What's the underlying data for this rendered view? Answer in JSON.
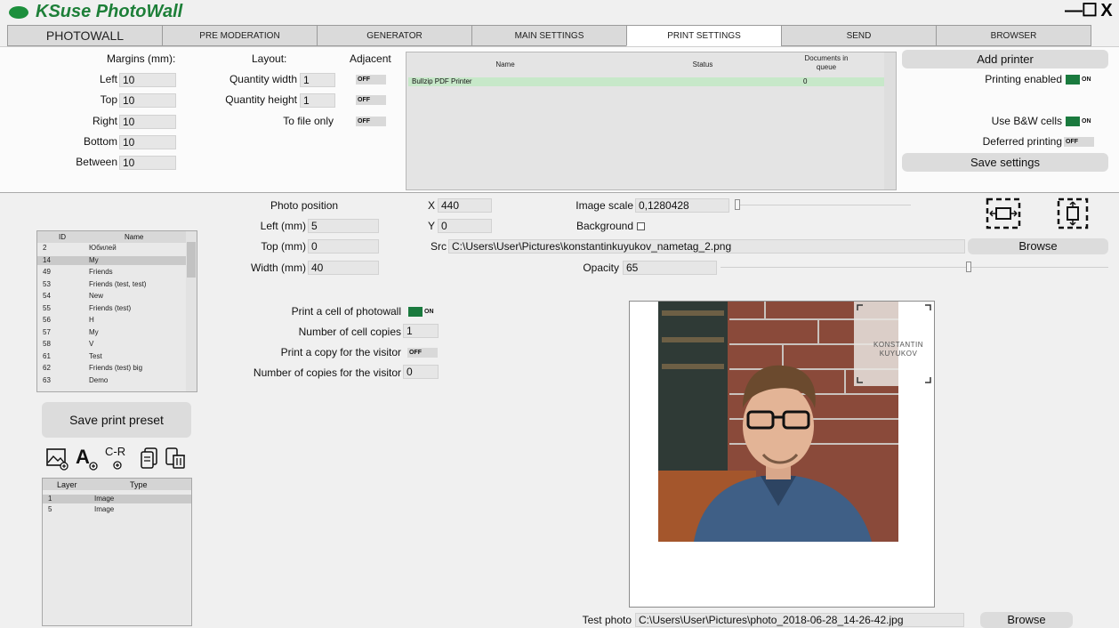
{
  "app": {
    "title": "KSuse PhotoWall"
  },
  "window": {
    "minimize": "—",
    "maximize": "☐",
    "close": "X"
  },
  "tabs": [
    "PHOTOWALL",
    "PRE MODERATION",
    "GENERATOR",
    "MAIN SETTINGS",
    "PRINT SETTINGS",
    "SEND",
    "BROWSER"
  ],
  "margins": {
    "header": "Margins (mm):",
    "left_label": "Left",
    "left": "10",
    "top_label": "Top",
    "top": "10",
    "right_label": "Right",
    "right": "10",
    "bottom_label": "Bottom",
    "bottom": "10",
    "between_label": "Between",
    "between": "10"
  },
  "layout": {
    "header": "Layout:",
    "adjacent_header": "Adjacent",
    "qty_width_label": "Quantity width",
    "qty_width": "1",
    "qty_height_label": "Quantity height",
    "qty_height": "1",
    "to_file_label": "To file only",
    "toggles": [
      "OFF",
      "OFF",
      "OFF"
    ]
  },
  "printers": {
    "col_name": "Name",
    "col_status": "Status",
    "col_docs": "Documents in queue",
    "rows": [
      {
        "name": "Bullzip PDF Printer",
        "status": "",
        "docs": "0"
      }
    ]
  },
  "printing": {
    "add_printer": "Add printer",
    "enabled_label": "Printing enabled",
    "enabled": "ON",
    "bw_label": "Use B&W cells",
    "bw": "ON",
    "deferred_label": "Deferred printing",
    "deferred": "OFF",
    "save_settings": "Save settings"
  },
  "photo_position": {
    "header": "Photo position",
    "left_label": "Left (mm)",
    "left": "5",
    "top_label": "Top (mm)",
    "top": "0",
    "width_label": "Width (mm)",
    "width": "40"
  },
  "layer_props": {
    "x_label": "X",
    "x": "440",
    "y_label": "Y",
    "y": "0",
    "scale_label": "Image scale",
    "scale": "0,1280428",
    "background_label": "Background",
    "src_label": "Src",
    "src": "C:\\Users\\User\\Pictures\\konstantinkuyukov_nametag_2.png",
    "browse": "Browse",
    "opacity_label": "Opacity",
    "opacity": "65"
  },
  "presets": {
    "col_id": "ID",
    "col_name": "Name",
    "rows": [
      [
        "2",
        "Юбилей"
      ],
      [
        "14",
        "My"
      ],
      [
        "49",
        "Friends"
      ],
      [
        "53",
        "Friends (test, test)"
      ],
      [
        "54",
        "New"
      ],
      [
        "55",
        "Friends (test)"
      ],
      [
        "56",
        "H"
      ],
      [
        "57",
        "My"
      ],
      [
        "58",
        "V"
      ],
      [
        "61",
        "Test"
      ],
      [
        "62",
        "Friends (test) big"
      ],
      [
        "63",
        "Demo"
      ]
    ],
    "selected_index": 1,
    "save": "Save print preset"
  },
  "tool_icons": [
    "add-image-icon",
    "add-text-icon",
    "add-code-icon",
    "copy-layer-icon",
    "delete-layer-icon"
  ],
  "code_icon_text": "C-R",
  "layers": {
    "col_layer": "Layer",
    "col_type": "Type",
    "rows": [
      [
        "1",
        "Image"
      ],
      [
        "5",
        "Image"
      ]
    ],
    "selected_index": 0
  },
  "cell_print": {
    "print_cell_label": "Print a cell of photowall",
    "print_cell": "ON",
    "cell_copies_label": "Number of cell copies",
    "cell_copies": "1",
    "visitor_copy_label": "Print a copy for the visitor",
    "visitor_copy": "OFF",
    "visitor_copies_label": "Number of copies for the visitor",
    "visitor_copies": "0"
  },
  "nametag": {
    "line1": "KONSTANTIN",
    "line2": "KUYUKOV"
  },
  "test_photo": {
    "label": "Test photo",
    "path": "C:\\Users\\User\\Pictures\\photo_2018-06-28_14-26-42.jpg",
    "browse": "Browse"
  },
  "colors": {
    "accent": "#1a7a3e",
    "title": "#1d7f38",
    "printer_row": "#c7e8c9"
  }
}
